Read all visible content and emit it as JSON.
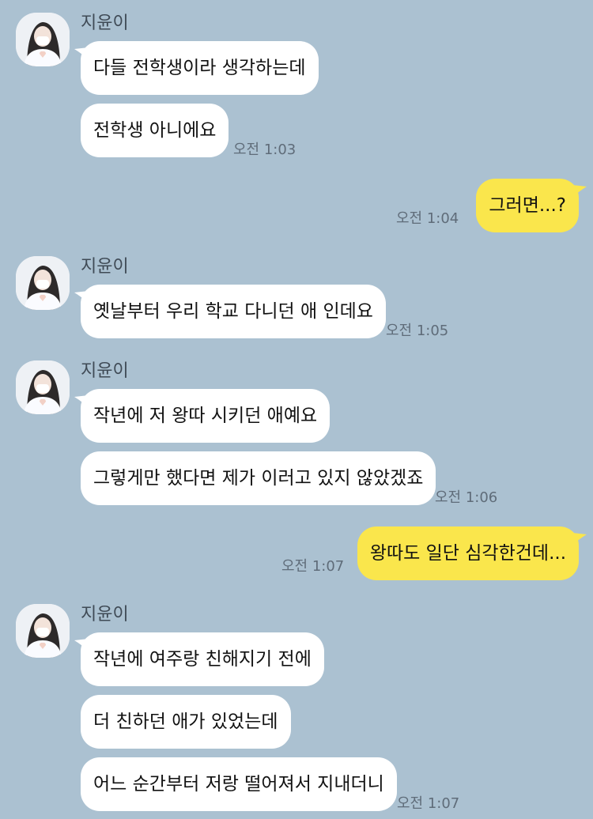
{
  "messages": {
    "g1": {
      "sender": "지윤이",
      "m1": "다들 전학생이라 생각하는데",
      "m2": "전학생 아니에요",
      "time": "오전 1:03"
    },
    "me1": {
      "text": "그러면...?",
      "time": "오전 1:04"
    },
    "g2": {
      "sender": "지윤이",
      "m1": "옛날부터 우리 학교 다니던 애 인데요",
      "time": "오전 1:05"
    },
    "g3": {
      "sender": "지윤이",
      "m1": "작년에 저 왕따 시키던 애예요",
      "m2": "그렇게만 했다면 제가 이러고 있지 않았겠죠",
      "time": "오전 1:06"
    },
    "me2": {
      "text": "왕따도 일단 심각한건데...",
      "time": "오전 1:07"
    },
    "g4": {
      "sender": "지윤이",
      "m1": "작년에 여주랑 친해지기 전에",
      "m2": "더 친하던 애가 있었는데",
      "m3": "어느 순간부터 저랑 떨어져서 지내더니",
      "time": "오전 1:07"
    }
  },
  "colors": {
    "background": "#abc1d1",
    "my_bubble": "#fae64c",
    "their_bubble": "#ffffff"
  }
}
